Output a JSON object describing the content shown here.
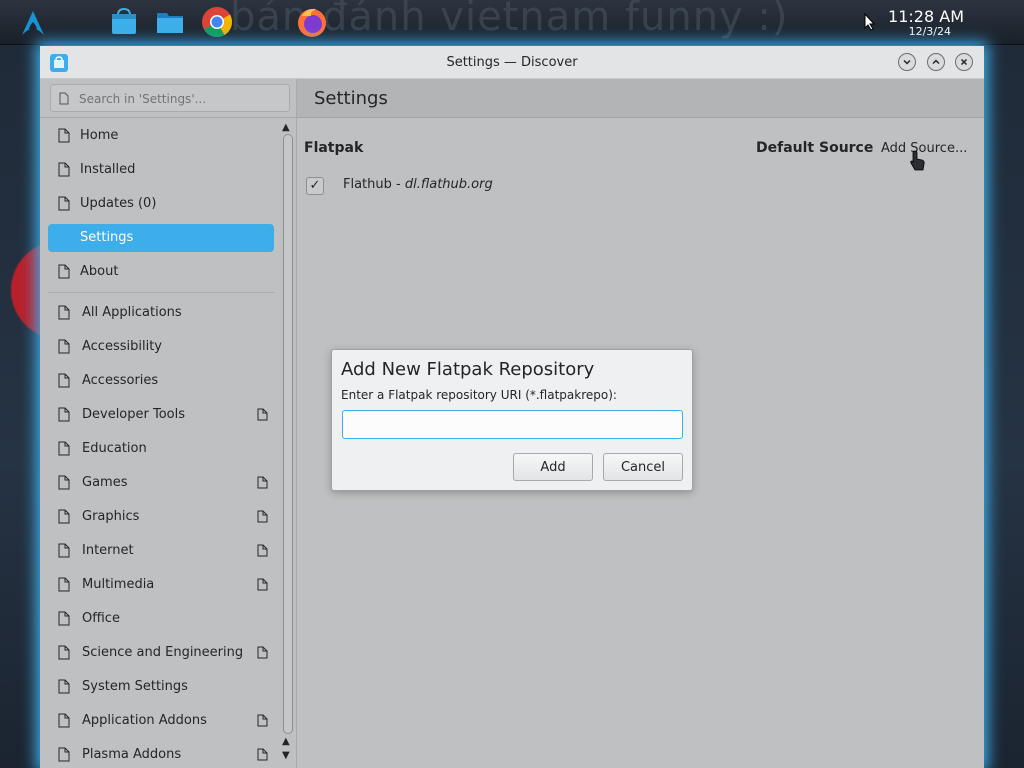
{
  "taskbar": {
    "wallpaper_text": "bản đánh vietnam funny :)",
    "launchers": [
      "arch-linux-icon",
      "discover-store-icon",
      "file-manager-icon",
      "chrome-browser-icon",
      "firefox-browser-icon"
    ],
    "clock_time": "11:28 AM",
    "clock_date": "12/3/24"
  },
  "window": {
    "title": "Settings — Discover",
    "buttons": [
      "minimize",
      "maximize",
      "close"
    ]
  },
  "sidebar": {
    "search_placeholder": "Search in 'Settings'...",
    "nav_items": [
      {
        "label": "Home"
      },
      {
        "label": "Installed"
      },
      {
        "label": "Updates (0)"
      },
      {
        "label": "Settings",
        "selected": true
      },
      {
        "label": "About"
      }
    ],
    "categories": [
      {
        "label": "All Applications",
        "has_extra": false
      },
      {
        "label": "Accessibility",
        "has_extra": false
      },
      {
        "label": "Accessories",
        "has_extra": false
      },
      {
        "label": "Developer Tools",
        "has_extra": true
      },
      {
        "label": "Education",
        "has_extra": false
      },
      {
        "label": "Games",
        "has_extra": true
      },
      {
        "label": "Graphics",
        "has_extra": true
      },
      {
        "label": "Internet",
        "has_extra": true
      },
      {
        "label": "Multimedia",
        "has_extra": true
      },
      {
        "label": "Office",
        "has_extra": false
      },
      {
        "label": "Science and Engineering",
        "has_extra": true
      },
      {
        "label": "System Settings",
        "has_extra": false
      },
      {
        "label": "Application Addons",
        "has_extra": true
      },
      {
        "label": "Plasma Addons",
        "has_extra": true
      }
    ]
  },
  "main": {
    "page_title": "Settings",
    "source_heading": "Flatpak",
    "default_source_label": "Default Source",
    "add_source_label": "Add Source...",
    "repository": {
      "name": "Flathub - ",
      "url": "dl.flathub.org",
      "enabled": true,
      "check_mark": "✓"
    }
  },
  "dialog": {
    "title": "Add New Flatpak Repository",
    "prompt": "Enter a Flatpak repository URI (*.flatpakrepo):",
    "input_value": "",
    "add_label": "Add",
    "cancel_label": "Cancel"
  },
  "colors": {
    "accent": "#3daee9",
    "window_bg": "#bfc0c1",
    "dialog_bg": "#eff0f1"
  }
}
